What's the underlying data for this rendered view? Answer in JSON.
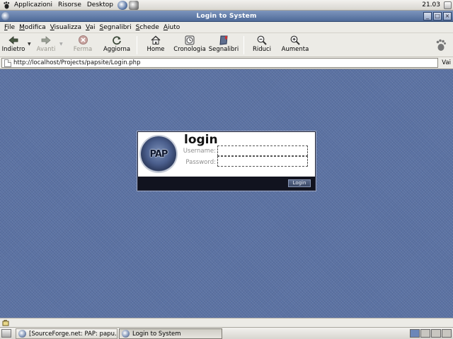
{
  "top_panel": {
    "menus": [
      "Applicazioni",
      "Risorse",
      "Desktop"
    ],
    "clock": "21.03"
  },
  "window": {
    "title": "Login to System"
  },
  "menubar": {
    "items": [
      {
        "underline": "F",
        "rest": "ile"
      },
      {
        "underline": "M",
        "rest": "odifica"
      },
      {
        "underline": "V",
        "rest": "isualizza"
      },
      {
        "underline": "V",
        "rest": "ai"
      },
      {
        "underline": "S",
        "rest": "egnalibri"
      },
      {
        "underline": "S",
        "rest": "chede"
      },
      {
        "underline": "A",
        "rest": "iuto"
      }
    ]
  },
  "toolbar": {
    "back": "Indietro",
    "forward": "Avanti",
    "stop": "Ferma",
    "reload": "Aggiorna",
    "home": "Home",
    "history": "Cronologia",
    "bookmarks": "Segnalibri",
    "zoom_out": "Riduci",
    "zoom_in": "Aumenta"
  },
  "location": {
    "url": "http://localhost/Projects/papsite/Login.php",
    "go": "Vai"
  },
  "login": {
    "heading": "login",
    "logo_text": "PAP",
    "username_label": "Username:",
    "username_value": "",
    "password_label": "Password:",
    "password_value": "",
    "button": "Login"
  },
  "taskbar": {
    "tasks": [
      {
        "label": "[SourceForge.net: PAP: papu...",
        "active": false
      },
      {
        "label": "Login to System",
        "active": true
      }
    ]
  },
  "colors": {
    "desktop_blue": "#5b72a3",
    "titlebar": "#5e78a6",
    "login_footer": "#11131f"
  }
}
